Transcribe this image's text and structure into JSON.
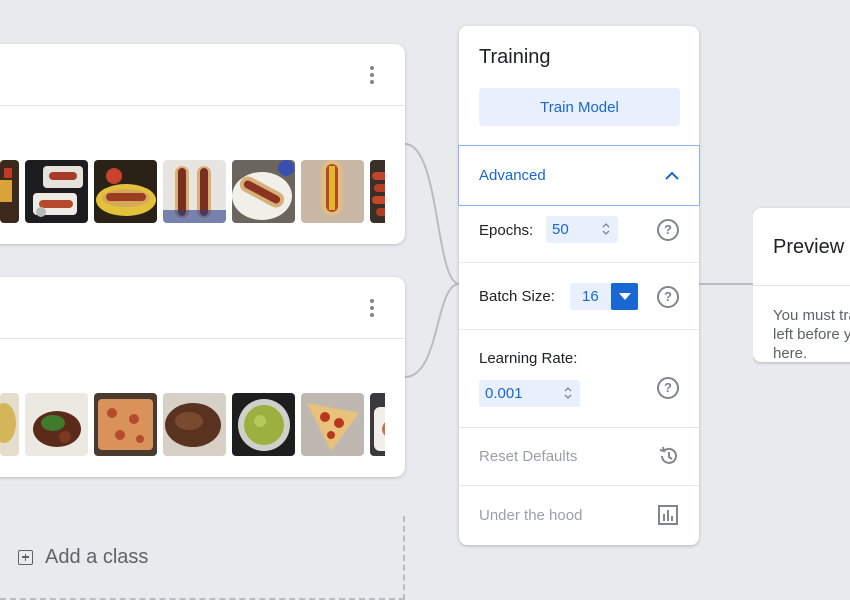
{
  "classes": [
    {
      "id": "hot-dog",
      "thumbnails": [
        "fries-plate",
        "hotdog-plates",
        "hotdog-tray",
        "two-hotdogs",
        "hotdog-blue-plate",
        "hotdog-closeup",
        "hotdog-held",
        "sausages"
      ]
    },
    {
      "id": "not-hot-dog",
      "thumbnails": [
        "food-edge",
        "braised-meat",
        "pizza-pan",
        "steak",
        "guacamole",
        "pizza-slice",
        "pasta"
      ]
    }
  ],
  "add_class": {
    "label": "Add a class"
  },
  "training": {
    "title": "Training",
    "train_button": "Train Model",
    "advanced": {
      "label": "Advanced",
      "expanded": true
    },
    "epochs": {
      "label": "Epochs:",
      "value": "50"
    },
    "batch_size": {
      "label": "Batch Size:",
      "value": "16"
    },
    "learning_rate": {
      "label": "Learning Rate:",
      "value": "0.001"
    },
    "reset_defaults": "Reset Defaults",
    "under_the_hood": "Under the hood"
  },
  "preview": {
    "title": "Preview",
    "message": "You must train a model on the left before you can preview it here."
  },
  "colors": {
    "accent": "#1967d2",
    "accent_light": "#e8f0fe",
    "background": "#e8eaed"
  },
  "icons": [
    "kebab-menu-icon",
    "chevron-up-icon",
    "help-icon",
    "history-icon",
    "bar-chart-icon",
    "add-box-icon"
  ]
}
